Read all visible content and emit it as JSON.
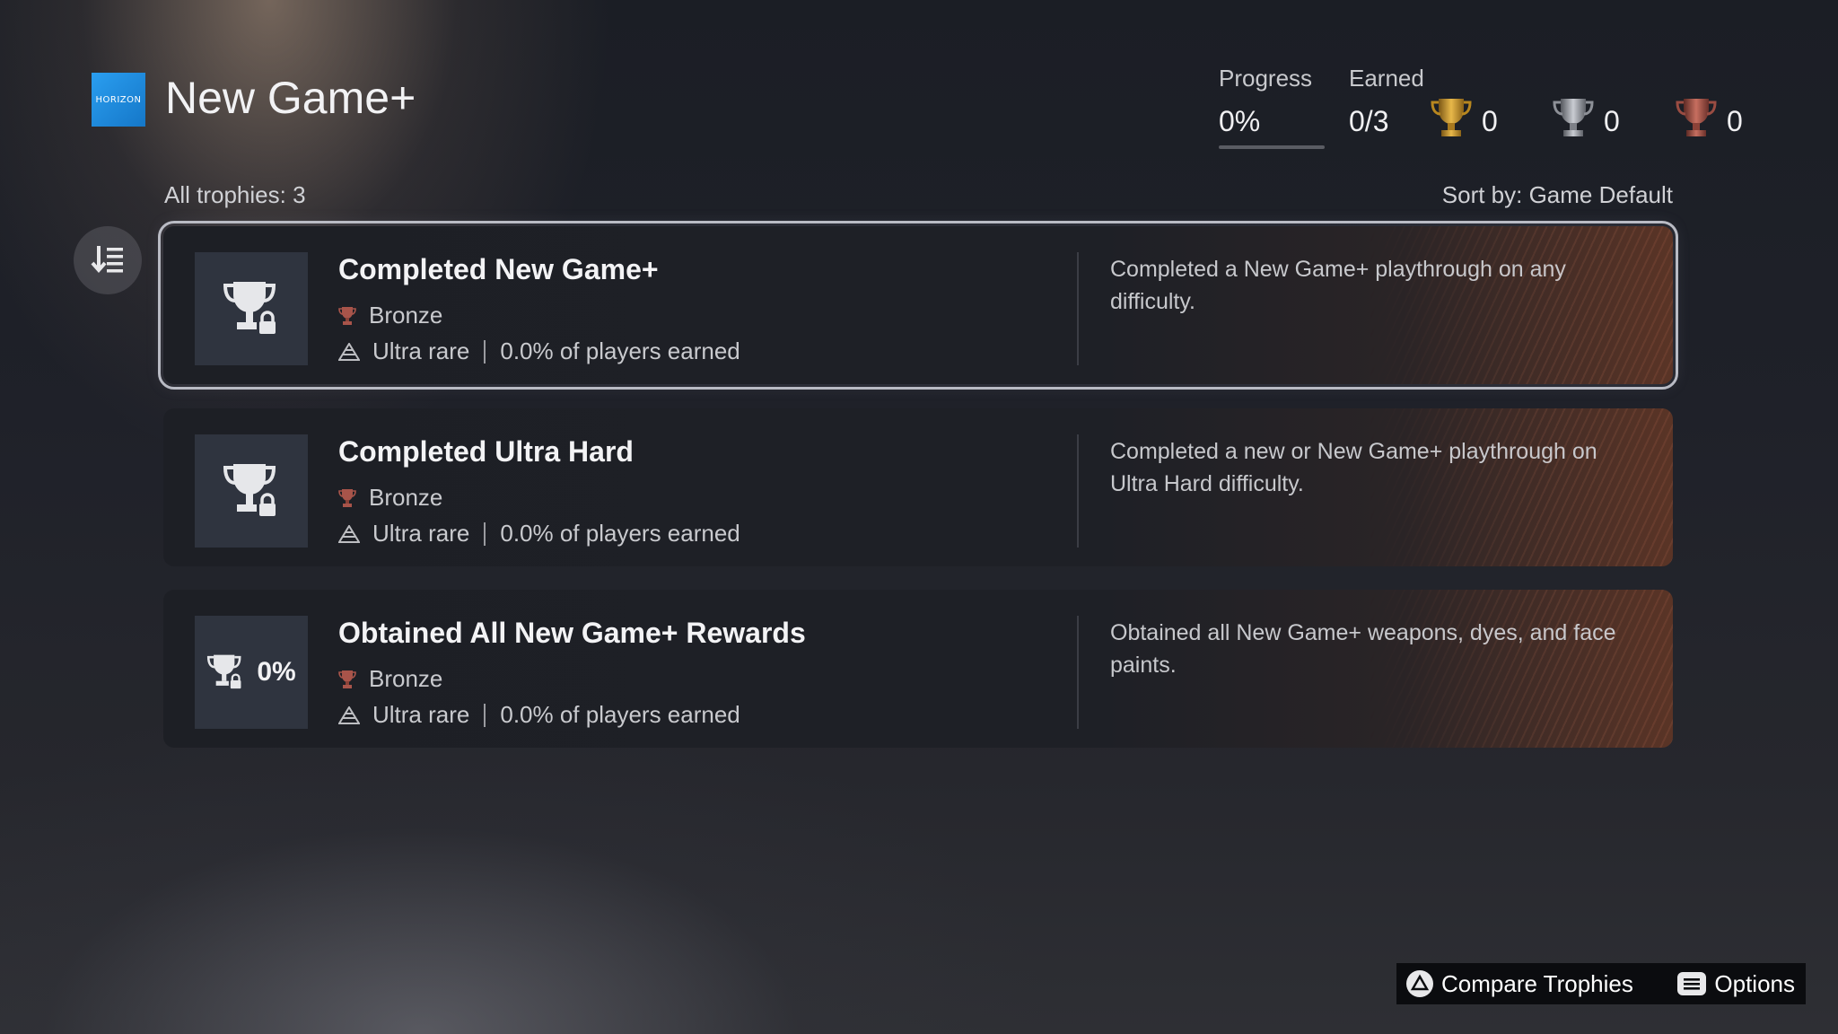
{
  "header": {
    "game_logo_text": "HORIZON",
    "title": "New Game+",
    "progress_label": "Progress",
    "progress_value": "0%",
    "progress_fraction": 0,
    "earned_label": "Earned",
    "earned_value": "0/3",
    "gold_count": "0",
    "silver_count": "0",
    "bronze_count": "0"
  },
  "list": {
    "all_trophies": "All trophies: 3",
    "sort_by": "Sort by: Game Default"
  },
  "trophies": [
    {
      "title": "Completed New Game+",
      "grade": "Bronze",
      "rarity": "Ultra rare",
      "earned_text": "0.0% of players earned",
      "description": "Completed a New Game+ playthrough on any difficulty."
    },
    {
      "title": "Completed Ultra Hard",
      "grade": "Bronze",
      "rarity": "Ultra rare",
      "earned_text": "0.0% of players earned",
      "description": "Completed a new or New Game+ playthrough on Ultra Hard difficulty."
    },
    {
      "title": "Obtained All New Game+ Rewards",
      "grade": "Bronze",
      "rarity": "Ultra rare",
      "earned_text": "0.0% of players earned",
      "description": "Obtained all New Game+ weapons, dyes, and face paints.",
      "progress": "0%"
    }
  ],
  "footer": {
    "compare_label": "Compare Trophies",
    "options_label": "Options"
  },
  "colors": {
    "gold": "#c9972e",
    "silver": "#9a9ea6",
    "bronze": "#a8544a",
    "accent_blue": "#1f8ae0"
  },
  "icons": [
    "sort-icon",
    "trophy-lock-icon",
    "bronze-trophy-icon",
    "rarity-icon",
    "triangle-button-icon",
    "options-button-icon",
    "gold-trophy-icon",
    "silver-trophy-icon"
  ]
}
